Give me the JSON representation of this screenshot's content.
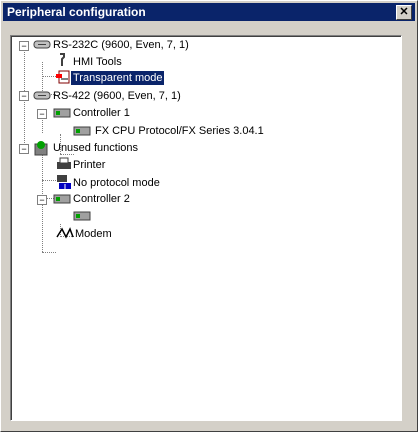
{
  "window": {
    "title": "Peripheral configuration",
    "close_glyph": "✕"
  },
  "tree": {
    "rs232": {
      "label": "RS-232C (9600, Even, 7, 1)",
      "icon": "port-icon"
    },
    "hmi": {
      "label": "HMI Tools",
      "icon": "tools-icon"
    },
    "transparent": {
      "label": "Transparent mode",
      "icon": "transparent-mode-icon",
      "selected": true
    },
    "rs422": {
      "label": "RS-422 (9600, Even, 7, 1)",
      "icon": "port-icon"
    },
    "controller1": {
      "label": "Controller 1",
      "icon": "controller-icon"
    },
    "fxcpu": {
      "label": "FX CPU Protocol/FX Series 3.04.1",
      "icon": "controller-icon"
    },
    "unused": {
      "label": "Unused functions",
      "icon": "unused-functions-icon"
    },
    "printer": {
      "label": "Printer",
      "icon": "printer-icon"
    },
    "noproto": {
      "label": "No protocol mode",
      "icon": "no-protocol-icon"
    },
    "controller2": {
      "label": "Controller 2",
      "icon": "controller-icon"
    },
    "modem": {
      "label": "Modem",
      "icon": "modem-icon"
    }
  }
}
